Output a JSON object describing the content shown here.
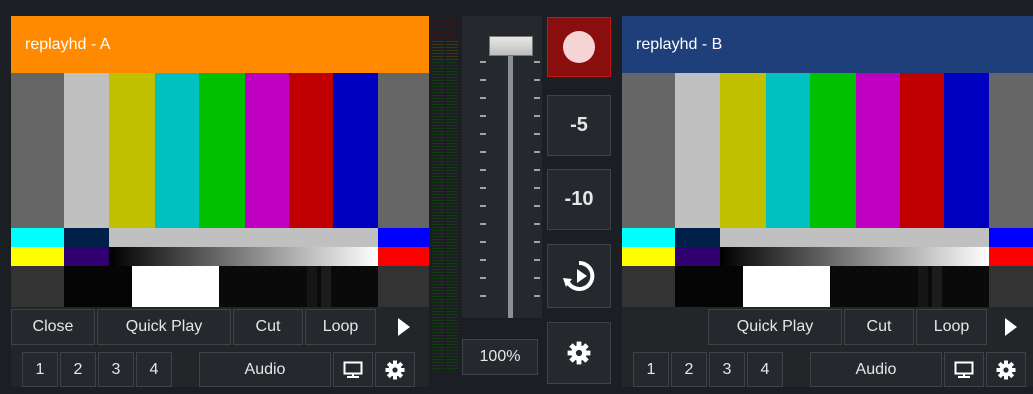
{
  "deck_a": {
    "title": "replayhd - A",
    "title_color": "#ff8a00",
    "buttons_row1": [
      "Close",
      "Quick Play",
      "Cut",
      "Loop"
    ],
    "buttons_row2": [
      "1",
      "2",
      "3",
      "4",
      "Audio"
    ],
    "play_icon": "play-icon",
    "monitor_icon": "monitor-icon",
    "gear_icon": "gear-icon"
  },
  "deck_b": {
    "title": "replayhd - B",
    "title_color": "#1f3f7a",
    "buttons_row1": [
      "Quick Play",
      "Cut",
      "Loop"
    ],
    "buttons_row2": [
      "1",
      "2",
      "3",
      "4",
      "Audio"
    ],
    "play_icon": "play-icon",
    "monitor_icon": "monitor-icon",
    "gear_icon": "gear-icon"
  },
  "center": {
    "record_icon": "record-icon",
    "skip_back_5": "-5",
    "skip_back_10": "-10",
    "replay_icon": "replay-icon",
    "speed": "100%",
    "settings_icon": "gear-icon",
    "fader_level": 1.0
  }
}
